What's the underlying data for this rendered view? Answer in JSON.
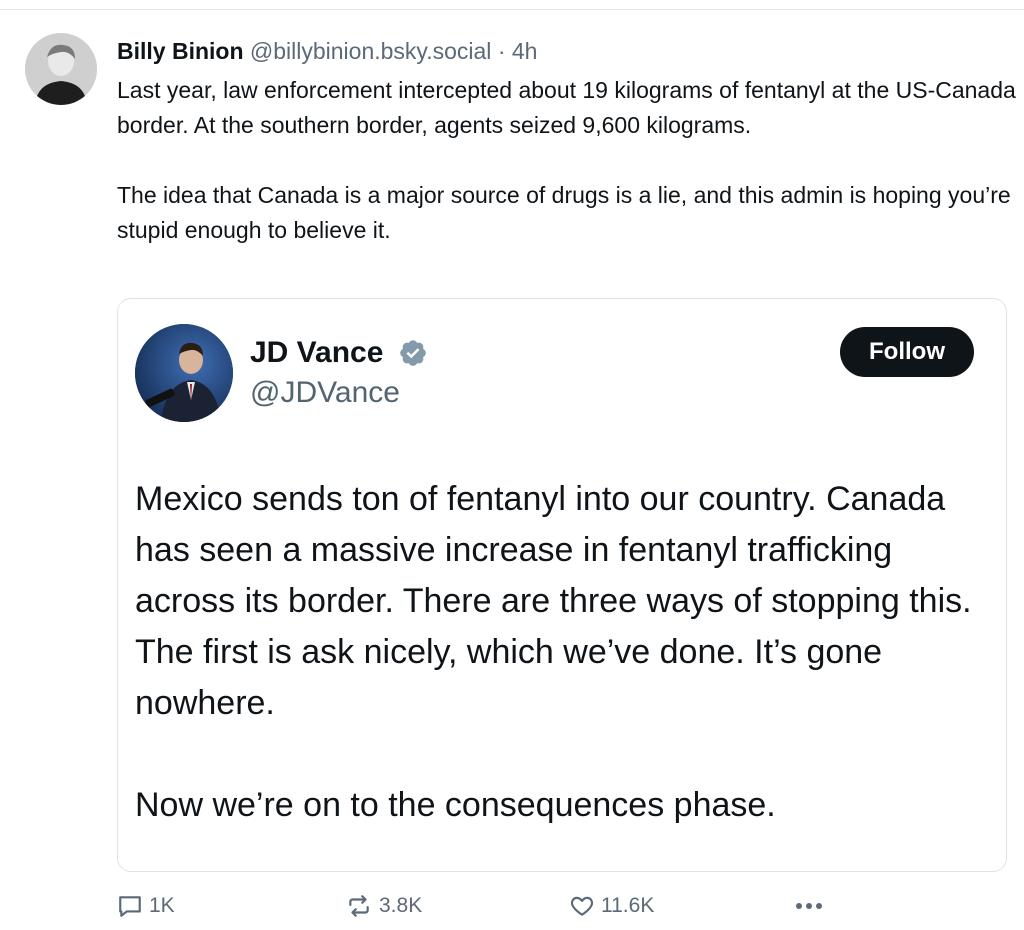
{
  "post": {
    "author_name": "Billy Binion",
    "author_handle": "@billybinion.bsky.social",
    "separator": "·",
    "time": "4h",
    "paragraphs": [
      "Last year, law enforcement intercepted about 19 kilograms of fentanyl at the US-Canada border. At the southern border, agents seized 9,600 kilograms.",
      "The idea that Canada is a major source of drugs is a lie, and this admin is hoping you’re stupid enough to believe it."
    ]
  },
  "quote": {
    "name": "JD Vance",
    "handle": "@JDVance",
    "follow_label": "Follow",
    "verified_icon": "verified-badge-icon",
    "paragraphs": [
      "Mexico sends ton of fentanyl into our country. Canada has seen a massive increase in fentanyl trafficking across its border. There are three ways of stopping this. The first is ask nicely, which we’ve done. It’s gone nowhere.",
      "Now we’re on to the consequences phase."
    ]
  },
  "actions": {
    "replies": "1K",
    "reposts": "3.8K",
    "likes": "11.6K",
    "more_icon": "more-options-icon"
  },
  "colors": {
    "text": "#0f1419",
    "muted": "#5b6978",
    "border": "#dfe3e8",
    "follow_bg": "#0f1419"
  }
}
